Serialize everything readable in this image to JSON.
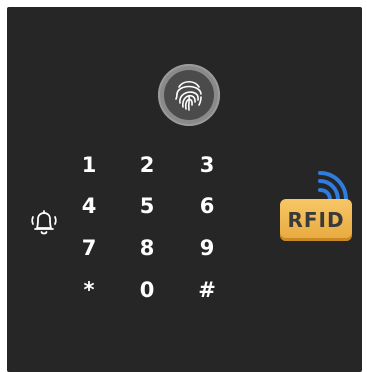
{
  "keypad": {
    "keys": [
      "1",
      "2",
      "3",
      "4",
      "5",
      "6",
      "7",
      "8",
      "9",
      "*",
      "0",
      "#"
    ]
  },
  "icons": {
    "fingerprint": "fingerprint-icon",
    "bell": "bell-icon",
    "rfid": "rfid-icon"
  },
  "rfid": {
    "label": "RFID"
  },
  "colors": {
    "panel": "#262626",
    "key_text": "#ffffff",
    "rfid_card": "#f0b654",
    "rfid_waves": "#2f7de0"
  }
}
